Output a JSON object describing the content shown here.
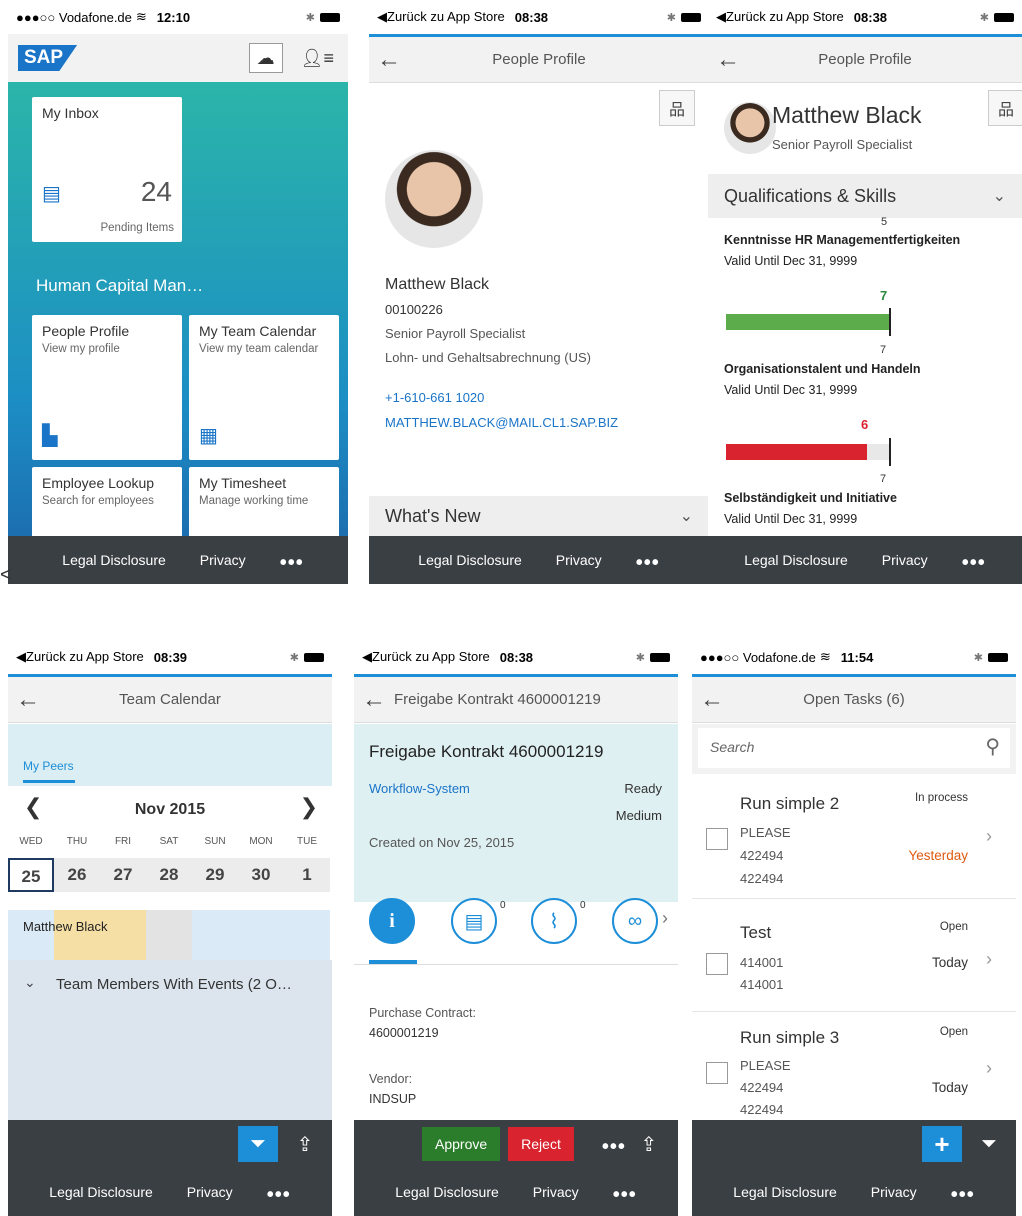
{
  "stray_char": "<",
  "screen1": {
    "status": {
      "carrier": "●●●○○ Vodafone.de",
      "wifi": "wifi-icon",
      "time": "12:10"
    },
    "brand": "SAP",
    "tiles": [
      {
        "title": "My Inbox",
        "count": "24",
        "unit": "Pending Items"
      },
      {
        "title": "People Profile",
        "sub": "View my profile"
      },
      {
        "title": "My Team Calendar",
        "sub": "View my team calendar"
      },
      {
        "title": "Employee Lookup",
        "sub": "Search for employees"
      },
      {
        "title": "My Timesheet",
        "sub": "Manage working time"
      }
    ],
    "group_title": "Human Capital Man…",
    "footer": {
      "legal": "Legal Disclosure",
      "privacy": "Privacy",
      "more": "•••"
    }
  },
  "screen2": {
    "status": {
      "back_app": "◀Zurück zu App Store",
      "time": "08:38"
    },
    "title": "People Profile",
    "name": "Matthew Black",
    "id": "00100226",
    "role": "Senior Payroll Specialist",
    "dept": "Lohn- und Gehaltsabrechnung (US)",
    "phone": "+1-610-661 1020",
    "email": "MATTHEW.BLACK@MAIL.CL1.SAP.BIZ",
    "section": "What's New",
    "footer": {
      "legal": "Legal Disclosure",
      "privacy": "Privacy",
      "more": "•••"
    }
  },
  "screen3": {
    "status": {
      "back_app": "◀Zurück zu App Store",
      "time": "08:38"
    },
    "title": "People Profile",
    "name": "Matthew Black",
    "role": "Senior Payroll Specialist",
    "section": "Qualifications & Skills",
    "top_num": "5",
    "skills": [
      {
        "name": "Kenntnisse HR Managementfertigkeiten",
        "valid": "Valid Until Dec 31, 9999"
      },
      {
        "name": "Organisationstalent und Handeln",
        "valid": "Valid Until Dec 31, 9999",
        "actual": "7",
        "required": "7",
        "actual_value": 7,
        "color": "#5cac4c"
      },
      {
        "name": "Selbständigkeit und Initiative",
        "valid": "Valid Until Dec 31, 9999",
        "actual": "6",
        "required": "7",
        "actual_value": 6,
        "color": "#d9232e"
      }
    ],
    "footer": {
      "legal": "Legal Disclosure",
      "privacy": "Privacy",
      "more": "•••"
    }
  },
  "screen4": {
    "status": {
      "back_app": "◀Zurück zu App Store",
      "time": "08:39"
    },
    "title": "Team Calendar",
    "tab": "My Peers",
    "month": "Nov 2015",
    "prev": "❮",
    "next": "❯",
    "days": [
      "WED",
      "THU",
      "FRI",
      "SAT",
      "SUN",
      "MON",
      "TUE"
    ],
    "dates": [
      "25",
      "26",
      "27",
      "28",
      "29",
      "30",
      "1"
    ],
    "person": "Matthew Black",
    "group": "Team Members With Events (2 O…",
    "footer": {
      "legal": "Legal Disclosure",
      "privacy": "Privacy",
      "more": "•••"
    }
  },
  "screen5": {
    "status": {
      "back_app": "◀Zurück zu App Store",
      "time": "08:38"
    },
    "title": "Freigabe Kontrakt 4600001219",
    "heading": "Freigabe Kontrakt 4600001219",
    "system": "Workflow-System",
    "status_text": "Ready",
    "priority": "Medium",
    "created": "Created on Nov 25, 2015",
    "notes_count": "0",
    "attach_count": "0",
    "field1_label": "Purchase Contract:",
    "field1_value": "4600001219",
    "field2_label": "Vendor:",
    "field2_value": "INDSUP",
    "approve": "Approve",
    "reject": "Reject",
    "more": "•••",
    "footer": {
      "legal": "Legal Disclosure",
      "privacy": "Privacy",
      "more": "•••"
    }
  },
  "screen6": {
    "status": {
      "carrier": "●●●○○ Vodafone.de",
      "time": "11:54"
    },
    "title": "Open Tasks (6)",
    "search_placeholder": "Search",
    "tasks": [
      {
        "title": "Run simple 2",
        "state": "In process",
        "line1": "PLEASE",
        "line2": "422494",
        "line3": "422494",
        "due": "Yesterday"
      },
      {
        "title": "Test",
        "state": "Open",
        "line1": "414001",
        "line2": "414001",
        "due": "Today"
      },
      {
        "title": "Run simple 3",
        "state": "Open",
        "line1": "PLEASE",
        "line2": "422494",
        "line3": "422494",
        "due": "Today"
      }
    ],
    "footer": {
      "legal": "Legal Disclosure",
      "privacy": "Privacy",
      "more": "•••"
    }
  }
}
